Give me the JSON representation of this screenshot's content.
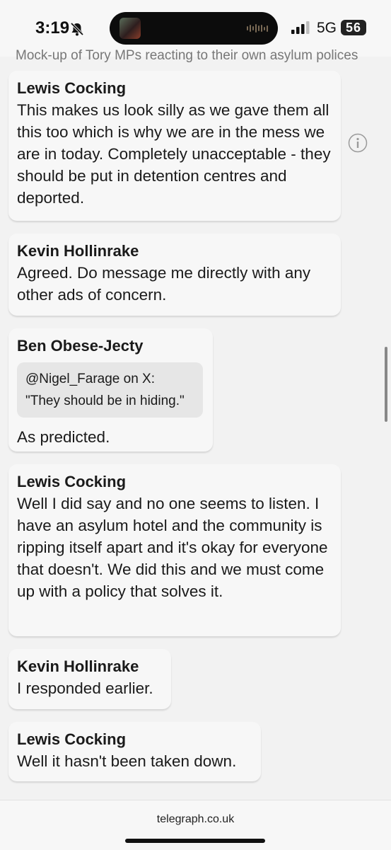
{
  "status_bar": {
    "time": "3:19",
    "network": "5G",
    "battery": "56"
  },
  "caption": "Mock-up of Tory MPs reacting to their own asylum polices",
  "messages": [
    {
      "sender": "Lewis Cocking",
      "text": "This makes us look silly as we gave them all this too which is why we are in the mess we are in today. Completely unacceptable - they should be put in detention centres and deported."
    },
    {
      "sender": "Kevin Hollinrake",
      "text": "Agreed. Do message me directly with any other ads of concern."
    },
    {
      "sender": "Ben Obese-Jecty",
      "quote_line1": "@Nigel_Farage on X:",
      "quote_line2": "\"They should be in hiding.\"",
      "text": "As predicted."
    },
    {
      "sender": "Lewis Cocking",
      "text": "Well I did say and no one seems to listen. I have an asylum hotel and the community is ripping itself apart and it's okay for everyone that doesn't. We did this and we must come up with a policy that solves it."
    },
    {
      "sender": "Kevin Hollinrake",
      "text": "I responded earlier."
    },
    {
      "sender": "Lewis Cocking",
      "text": "Well it hasn't been taken down."
    }
  ],
  "browser": {
    "url": "telegraph.co.uk"
  },
  "icons": {
    "info": "info-icon",
    "silent": "bell-slash-icon"
  }
}
